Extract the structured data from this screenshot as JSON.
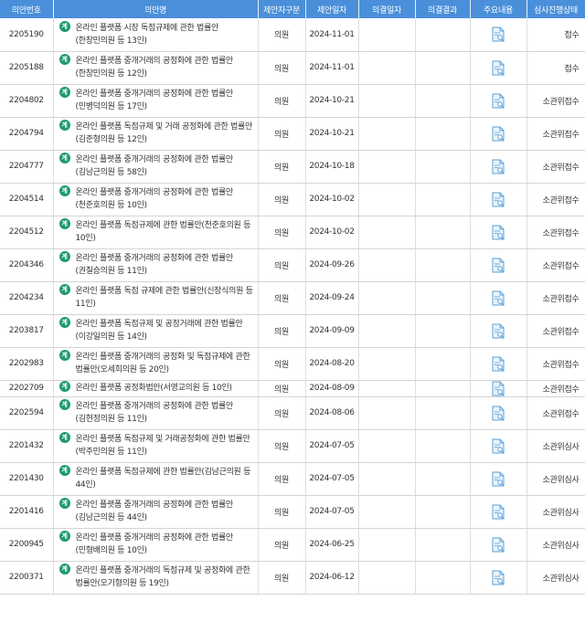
{
  "headers": [
    "의안번호",
    "의안명",
    "제안자구분",
    "제안일자",
    "의결일자",
    "의결결과",
    "주요내용",
    "심사진행상태"
  ],
  "badge_label": "계",
  "rows": [
    {
      "bill_no": "2205190",
      "title": "온라인 플랫폼 시장 독점규제에 관한 법률안(한창민의원 등 13인)",
      "proposer": "의원",
      "date": "2024-11-01",
      "resolution_date": "",
      "result": "",
      "status": "접수"
    },
    {
      "bill_no": "2205188",
      "title": "온라인 플랫폼 중개거래의 공정화에 관한 법률안(한창민의원 등 12인)",
      "proposer": "의원",
      "date": "2024-11-01",
      "resolution_date": "",
      "result": "",
      "status": "접수"
    },
    {
      "bill_no": "2204802",
      "title": "온라인 플랫폼 중개거래의 공정화에 관한 법률안(민병덕의원 등 17인)",
      "proposer": "의원",
      "date": "2024-10-21",
      "resolution_date": "",
      "result": "",
      "status": "소관위접수"
    },
    {
      "bill_no": "2204794",
      "title": "온라인 플랫폼 독점규제 및 거래 공정화에 관한 법률안(김준형의원 등 12인)",
      "proposer": "의원",
      "date": "2024-10-21",
      "resolution_date": "",
      "result": "",
      "status": "소관위접수"
    },
    {
      "bill_no": "2204777",
      "title": "온라인 플랫폼 중개거래의 공정화에 관한 법률안(김남근의원 등 58인)",
      "proposer": "의원",
      "date": "2024-10-18",
      "resolution_date": "",
      "result": "",
      "status": "소관위접수"
    },
    {
      "bill_no": "2204514",
      "title": "온라인 플랫폼 중개거래의 공정화에 관한 법률안(천준호의원 등 10인)",
      "proposer": "의원",
      "date": "2024-10-02",
      "resolution_date": "",
      "result": "",
      "status": "소관위접수"
    },
    {
      "bill_no": "2204512",
      "title": "온라인 플랫폼 독점규제에 관한 법률안(천준호의원 등 10인)",
      "proposer": "의원",
      "date": "2024-10-02",
      "resolution_date": "",
      "result": "",
      "status": "소관위접수"
    },
    {
      "bill_no": "2204346",
      "title": "온라인 플랫폼 중개거래의 공정화에 관한 법률안(권칠승의원 등 11인)",
      "proposer": "의원",
      "date": "2024-09-26",
      "resolution_date": "",
      "result": "",
      "status": "소관위접수"
    },
    {
      "bill_no": "2204234",
      "title": "온라인 플랫폼 독점 규제에 관한 법률안(신장식의원 등 11인)",
      "proposer": "의원",
      "date": "2024-09-24",
      "resolution_date": "",
      "result": "",
      "status": "소관위접수"
    },
    {
      "bill_no": "2203817",
      "title": "온라인 플랫폼 독점규제 및 공정거래에 관한 법률안(이강일의원 등 14인)",
      "proposer": "의원",
      "date": "2024-09-09",
      "resolution_date": "",
      "result": "",
      "status": "소관위접수"
    },
    {
      "bill_no": "2202983",
      "title": "온라인 플랫폼 중개거래의 공정화 및 독점규제에 관한 법률안(오세희의원 등 20인)",
      "proposer": "의원",
      "date": "2024-08-20",
      "resolution_date": "",
      "result": "",
      "status": "소관위접수"
    },
    {
      "bill_no": "2202709",
      "title": "온라인 플랫폼 공정화법안(서영교의원 등 10인)",
      "proposer": "의원",
      "date": "2024-08-09",
      "resolution_date": "",
      "result": "",
      "status": "소관위접수"
    },
    {
      "bill_no": "2202594",
      "title": "온라인 플랫폼 중개거래의 공정화에 관한 법률안(김현정의원 등 11인)",
      "proposer": "의원",
      "date": "2024-08-06",
      "resolution_date": "",
      "result": "",
      "status": "소관위접수"
    },
    {
      "bill_no": "2201432",
      "title": "온라인 플랫폼 독점규제 및 거래공정화에 관한 법률안(박주민의원 등 11인)",
      "proposer": "의원",
      "date": "2024-07-05",
      "resolution_date": "",
      "result": "",
      "status": "소관위심사"
    },
    {
      "bill_no": "2201430",
      "title": "온라인 플랫폼 독점규제에 관한 법률안(김남근의원 등 44인)",
      "proposer": "의원",
      "date": "2024-07-05",
      "resolution_date": "",
      "result": "",
      "status": "소관위심사"
    },
    {
      "bill_no": "2201416",
      "title": "온라인 플랫폼 중개거래의 공정화에 관한 법률안(김남근의원 등 44인)",
      "proposer": "의원",
      "date": "2024-07-05",
      "resolution_date": "",
      "result": "",
      "status": "소관위심사"
    },
    {
      "bill_no": "2200945",
      "title": "온라인 플랫폼 중개거래의 공정화에 관한 법률안(민형배의원 등 10인)",
      "proposer": "의원",
      "date": "2024-06-25",
      "resolution_date": "",
      "result": "",
      "status": "소관위심사"
    },
    {
      "bill_no": "2200371",
      "title": "온라인 플랫폼 중개거래의 독점규제 및 공정화에 관한 법률안(오기형의원 등 19인)",
      "proposer": "의원",
      "date": "2024-06-12",
      "resolution_date": "",
      "result": "",
      "status": "소관위심사"
    }
  ],
  "colors": {
    "header_bg": "#4a8fd9",
    "badge": "#1f9a6c",
    "doc_icon": "#5aa0d6"
  },
  "icons": {
    "badge": "law-badge-icon",
    "summary": "document-search-icon"
  }
}
